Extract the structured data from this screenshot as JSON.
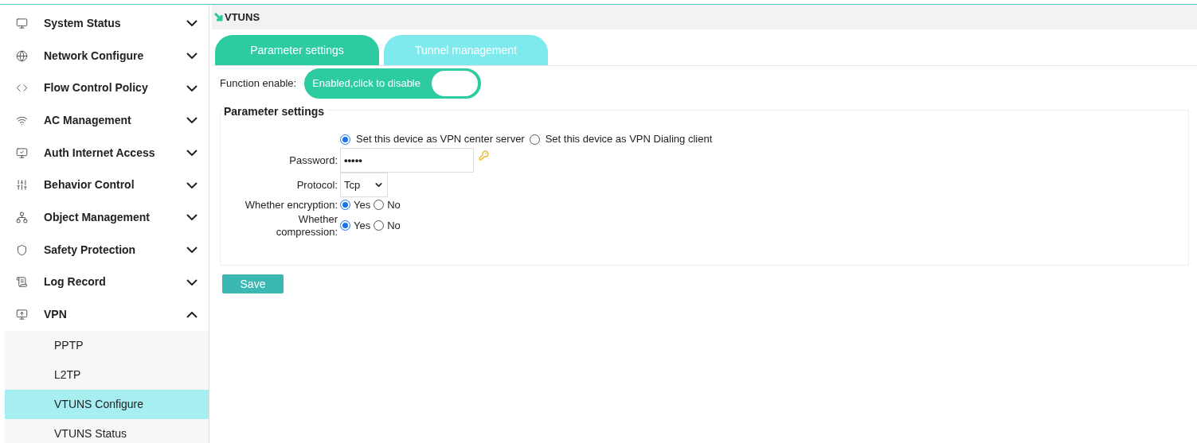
{
  "sidebar": {
    "items": [
      {
        "label": "System Status",
        "expanded": false
      },
      {
        "label": "Network Configure",
        "expanded": false
      },
      {
        "label": "Flow Control Policy",
        "expanded": false
      },
      {
        "label": "AC Management",
        "expanded": false
      },
      {
        "label": "Auth Internet Access",
        "expanded": false
      },
      {
        "label": "Behavior Control",
        "expanded": false
      },
      {
        "label": "Object Management",
        "expanded": false
      },
      {
        "label": "Safety Protection",
        "expanded": false
      },
      {
        "label": "Log Record",
        "expanded": false
      },
      {
        "label": "VPN",
        "expanded": true,
        "children": [
          {
            "label": "PPTP",
            "selected": false
          },
          {
            "label": "L2TP",
            "selected": false
          },
          {
            "label": "VTUNS Configure",
            "selected": true
          },
          {
            "label": "VTUNS Status",
            "selected": false
          }
        ]
      }
    ]
  },
  "page": {
    "title": "VTUNS",
    "tabs": [
      {
        "label": "Parameter settings",
        "selected": true
      },
      {
        "label": "Tunnel management",
        "selected": false
      }
    ],
    "function_enable": {
      "label": "Function enable:",
      "text": "Enabled,click to disable",
      "on": true
    },
    "section": {
      "title": "Parameter settings",
      "mode": [
        {
          "label": "Set this device as VPN center server",
          "selected": true
        },
        {
          "label": "Set this device as VPN Dialing client",
          "selected": false
        }
      ],
      "password": {
        "label": "Password:",
        "value": "•••••"
      },
      "protocol": {
        "label": "Protocol:",
        "value": "Tcp"
      },
      "encryption": {
        "label": "Whether encryption:",
        "options": [
          {
            "label": "Yes",
            "selected": true
          },
          {
            "label": "No",
            "selected": false
          }
        ]
      },
      "compression": {
        "label": "Whether compression:",
        "options": [
          {
            "label": "Yes",
            "selected": true
          },
          {
            "label": "No",
            "selected": false
          }
        ]
      }
    },
    "save": "Save"
  }
}
